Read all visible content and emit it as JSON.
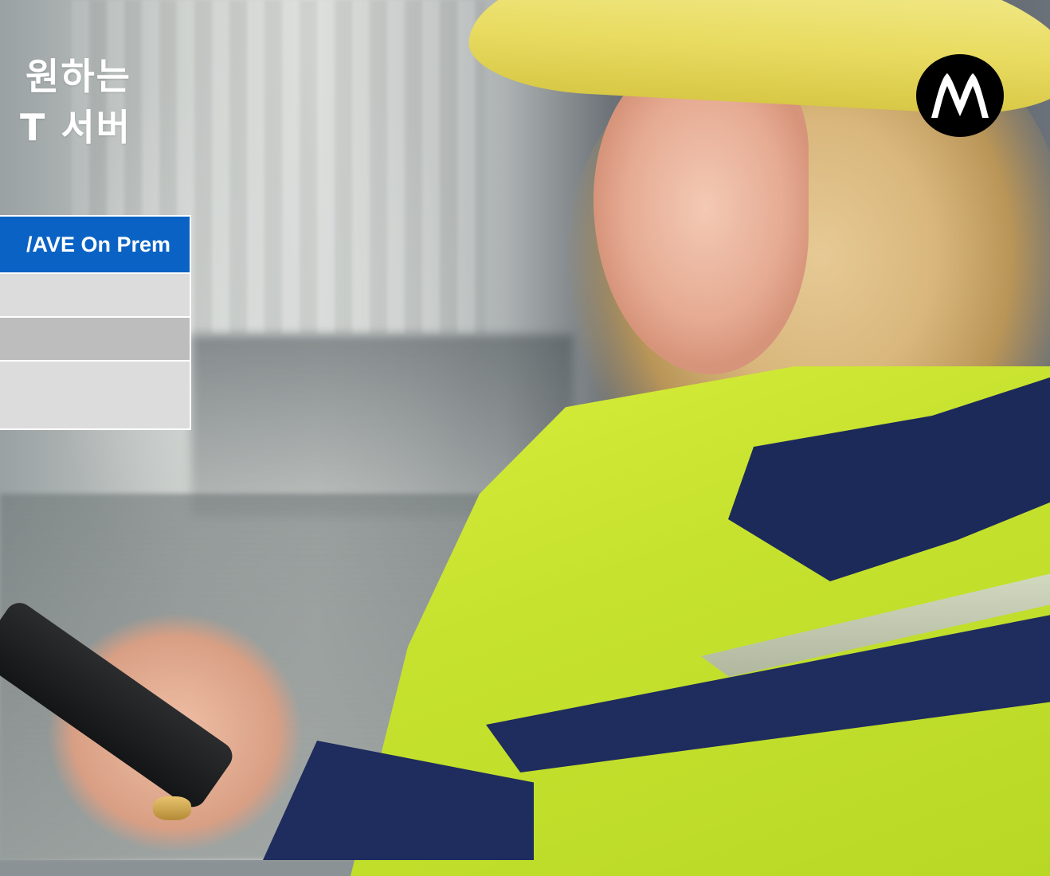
{
  "title": {
    "line1": "원하는",
    "line2": "T 서버"
  },
  "table": {
    "header": "/AVE On Prem",
    "rows": [
      "",
      "",
      ""
    ]
  },
  "colors": {
    "header_blue": "#0a63c4",
    "row_light": "#dcdcdc",
    "row_mid": "#bdbdbd",
    "logo_bg": "#000000"
  },
  "logo": {
    "icon": "motorola-batwing-logo"
  },
  "photo": {
    "subject": "worker-in-hard-hat-using-handheld-device"
  }
}
